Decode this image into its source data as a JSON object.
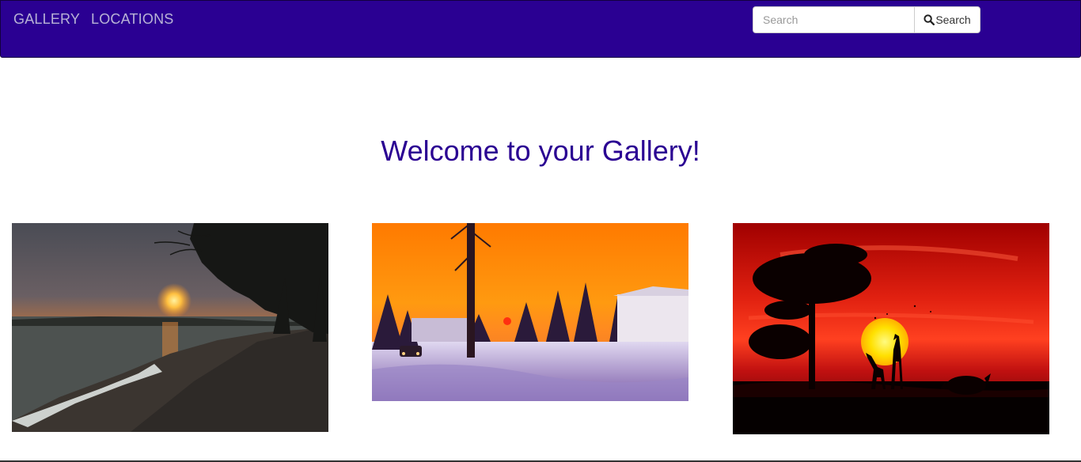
{
  "navbar": {
    "links": [
      {
        "label": "GALLERY"
      },
      {
        "label": "LOCATIONS"
      }
    ],
    "search": {
      "placeholder": "Search",
      "value": "",
      "button_label": "Search",
      "button_icon": "search-icon"
    }
  },
  "main": {
    "title": "Welcome to your Gallery!"
  },
  "gallery": {
    "images": [
      {
        "subject": "lake-beach-sunset-photo"
      },
      {
        "subject": "winter-street-sunset-photo"
      },
      {
        "subject": "savanna-giraffe-sunset-photo"
      }
    ]
  },
  "colors": {
    "navbar_bg": "#2a0092",
    "nav_link": "#b9b3d6",
    "title": "#2a0092"
  }
}
